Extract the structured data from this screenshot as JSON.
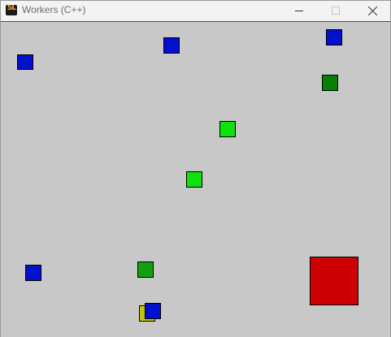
{
  "window": {
    "title": "Workers (C++)",
    "app_icon_text": "SL"
  },
  "colors": {
    "canvas_bg": "#c8c8c8",
    "blue": "#0010cc",
    "bright_green": "#10e010",
    "mid_green": "#10a010",
    "dark_green": "#088008",
    "yellow": "#c8c010",
    "red": "#cc0000"
  }
}
